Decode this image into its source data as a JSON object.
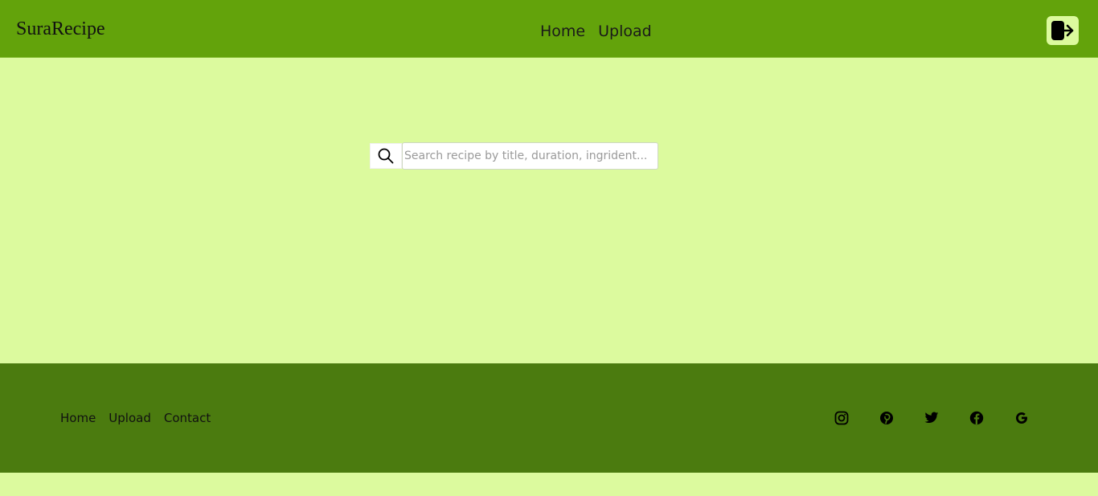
{
  "navbar": {
    "brand": "SuraRecipe",
    "links": [
      "Home",
      "Upload"
    ],
    "logout_icon": "logout-icon"
  },
  "search": {
    "placeholder": "Search recipe by title, duration, ingrident...",
    "value": "",
    "icon": "search-icon"
  },
  "footer": {
    "links": [
      "Home",
      "Upload",
      "Contact"
    ],
    "social_icons": [
      "instagram-icon",
      "pinterest-icon",
      "twitter-icon",
      "facebook-icon",
      "google-icon"
    ]
  },
  "colors": {
    "navbar_bg": "#63a30b",
    "page_bg": "#dcfa9e",
    "footer_bg": "#4b7b0f"
  }
}
